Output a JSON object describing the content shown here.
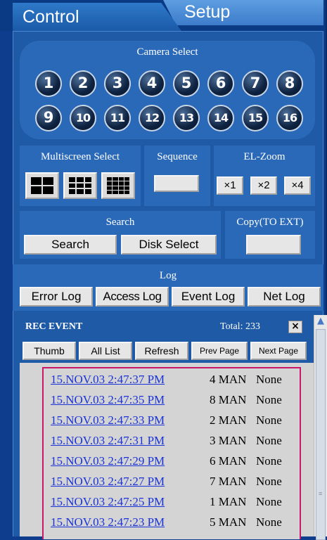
{
  "tabs": {
    "control": "Control",
    "setup": "Setup"
  },
  "camera_select": {
    "title": "Camera Select",
    "cameras": [
      "1",
      "2",
      "3",
      "4",
      "5",
      "6",
      "7",
      "8",
      "9",
      "10",
      "11",
      "12",
      "13",
      "14",
      "15",
      "16"
    ]
  },
  "multiscreen": {
    "title": "Multiscreen Select"
  },
  "sequence": {
    "title": "Sequence"
  },
  "el_zoom": {
    "title": "EL-Zoom",
    "x1": "×1",
    "x2": "×2",
    "x4": "×4"
  },
  "search": {
    "title": "Search",
    "search_btn": "Search",
    "disk_btn": "Disk Select"
  },
  "copy": {
    "title": "Copy(TO EXT)"
  },
  "log": {
    "title": "Log",
    "error": "Error Log",
    "access": "Access Log",
    "event": "Event Log",
    "net": "Net Log"
  },
  "rec_event": {
    "title": "REC EVENT",
    "total": "Total: 233",
    "close": "×",
    "buttons": {
      "thumb": "Thumb",
      "all_list": "All List",
      "refresh": "Refresh",
      "prev": "Prev Page",
      "next": "Next Page"
    },
    "rows": [
      {
        "time": "15.NOV.03 2:47:37 PM",
        "cam": "4 MAN",
        "note": "None"
      },
      {
        "time": "15.NOV.03 2:47:35 PM",
        "cam": "8 MAN",
        "note": "None"
      },
      {
        "time": "15.NOV.03 2:47:33 PM",
        "cam": "2 MAN",
        "note": "None"
      },
      {
        "time": "15.NOV.03 2:47:31 PM",
        "cam": "3 MAN",
        "note": "None"
      },
      {
        "time": "15.NOV.03 2:47:29 PM",
        "cam": "6 MAN",
        "note": "None"
      },
      {
        "time": "15.NOV.03 2:47:27 PM",
        "cam": "7 MAN",
        "note": "None"
      },
      {
        "time": "15.NOV.03 2:47:25 PM",
        "cam": "1 MAN",
        "note": "None"
      },
      {
        "time": "15.NOV.03 2:47:23 PM",
        "cam": "5 MAN",
        "note": "None"
      }
    ]
  },
  "colors": {
    "background": "#1f5aa6",
    "panel": "#2a69b8",
    "link": "#1a33d6",
    "list_border": "#c8186b"
  }
}
